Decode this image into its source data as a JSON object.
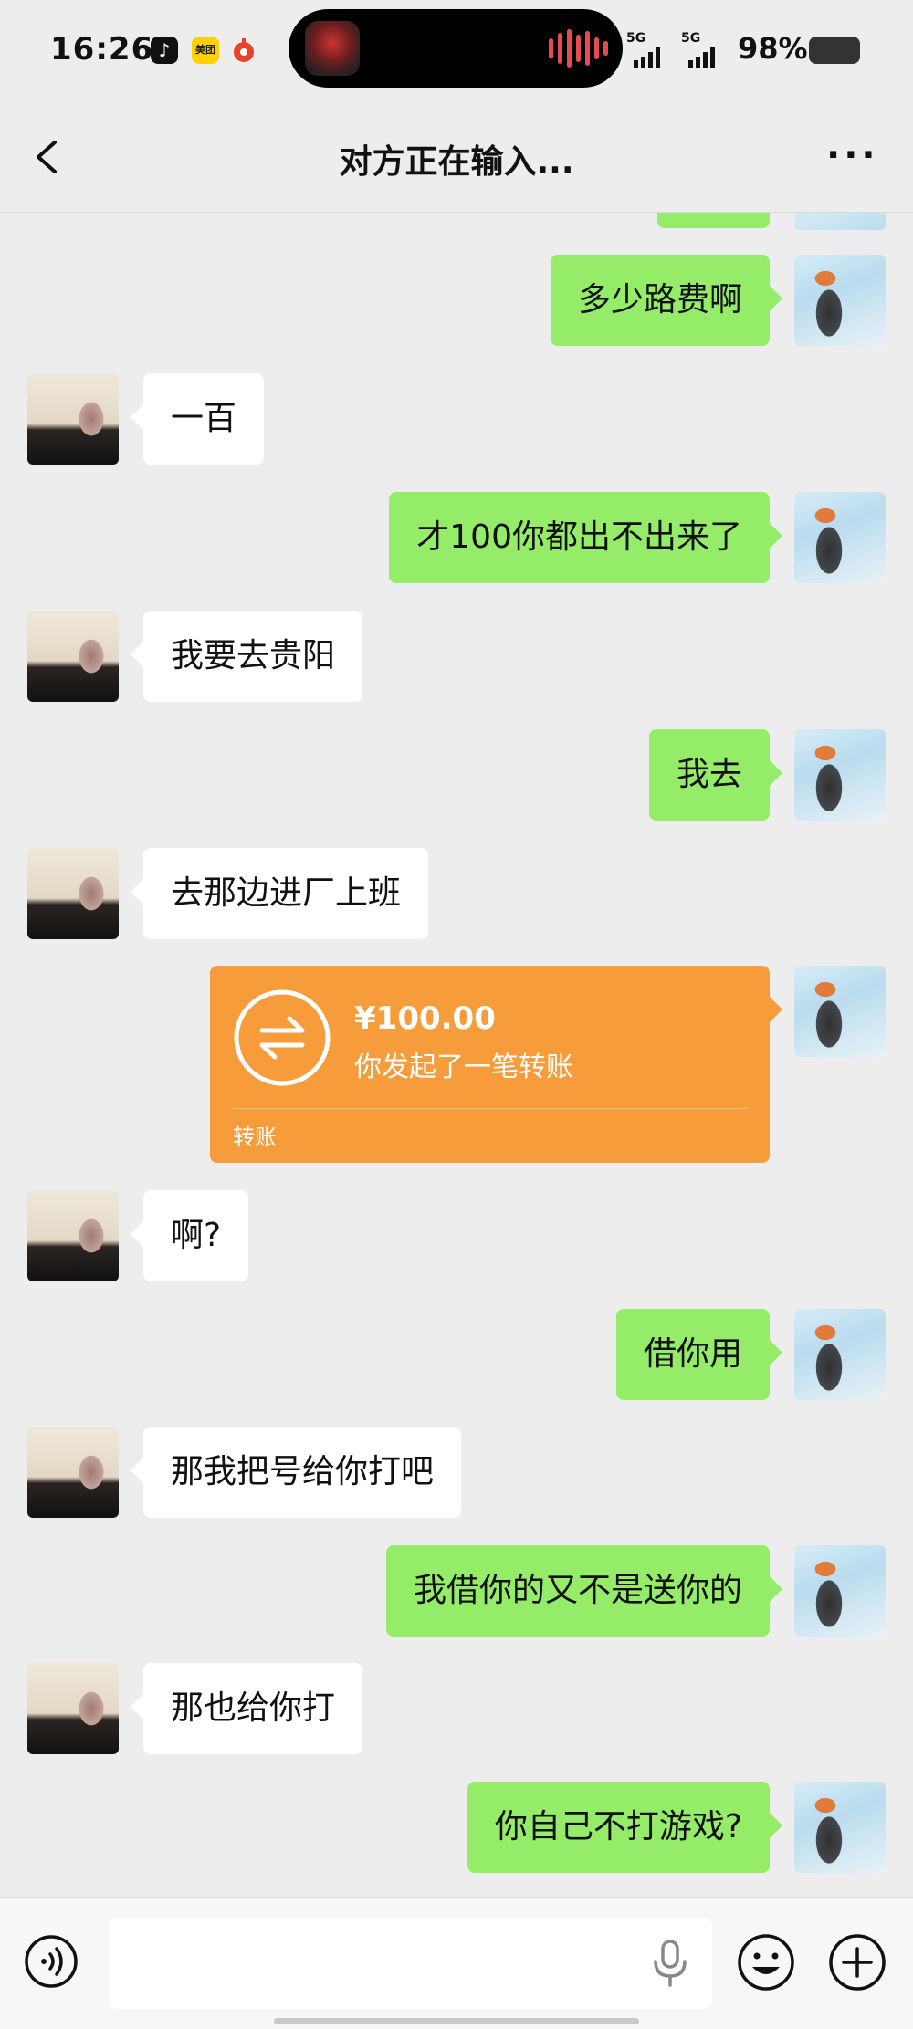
{
  "status_bar": {
    "time": "16:26",
    "apps": [
      "tiktok-icon",
      "美团",
      "red-app-icon"
    ],
    "signal_label_1": "5G",
    "signal_label_2": "5G",
    "battery": "98%"
  },
  "header": {
    "title": "对方正在输入..."
  },
  "messages": [
    {
      "side": "right",
      "text": "多少路费啊"
    },
    {
      "side": "left",
      "text": "一百"
    },
    {
      "side": "right",
      "text": "才100你都出不出来了"
    },
    {
      "side": "left",
      "text": "我要去贵阳"
    },
    {
      "side": "right",
      "text": "我去"
    },
    {
      "side": "left",
      "text": "去那边进厂上班"
    },
    {
      "side": "right",
      "type": "transfer",
      "amount": "¥100.00",
      "desc": "你发起了一笔转账",
      "label": "转账"
    },
    {
      "side": "left",
      "text": "啊?"
    },
    {
      "side": "right",
      "text": "借你用"
    },
    {
      "side": "left",
      "text": "那我把号给你打吧"
    },
    {
      "side": "right",
      "text": "我借你的又不是送你的"
    },
    {
      "side": "left",
      "text": "那也给你打"
    },
    {
      "side": "right",
      "text": "你自己不打游戏?"
    }
  ],
  "input": {
    "value": "",
    "placeholder": ""
  },
  "colors": {
    "background": "#ededed",
    "outgoing_bubble": "#95ec69",
    "incoming_bubble": "#ffffff",
    "transfer_card": "#f79c3a"
  }
}
